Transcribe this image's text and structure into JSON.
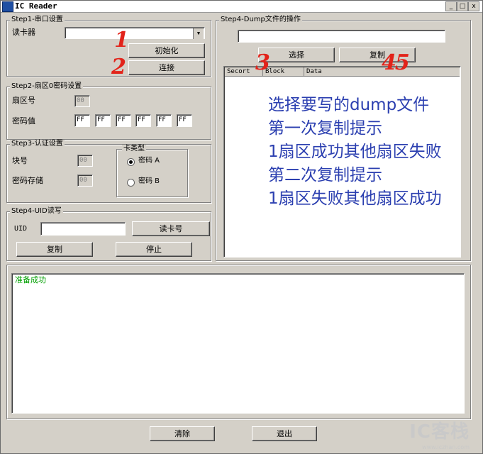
{
  "window": {
    "title": "IC Reader",
    "minimize_glyph": "_",
    "maximize_glyph": "□",
    "close_glyph": "x"
  },
  "step1": {
    "legend": "Step1-串口设置",
    "reader_label": "读卡器",
    "reader_value": "",
    "init_button": "初始化",
    "connect_button": "连接"
  },
  "step2": {
    "legend": "Step2-扇区0密码设置",
    "sector_label": "扇区号",
    "sector_value": "00",
    "password_label": "密码值",
    "password_bytes": [
      "FF",
      "FF",
      "FF",
      "FF",
      "FF",
      "FF"
    ]
  },
  "step3": {
    "legend": "Step3-认证设置",
    "block_label": "块号",
    "block_value": "00",
    "storage_label": "密码存储",
    "storage_value": "00",
    "card_type_legend": "卡类型",
    "option_a": "密码 A",
    "option_b": "密码 B",
    "selected": "A"
  },
  "step4_uid": {
    "legend": "Step4-UID读写",
    "uid_label": "UID",
    "uid_value": "",
    "read_button": "读卡号",
    "copy_button": "复制",
    "stop_button": "停止"
  },
  "step4_dump": {
    "legend": "Step4-Dump文件的操作",
    "file_path": "",
    "select_button": "选择",
    "copy_button": "复制",
    "columns": [
      "Secort",
      "Block",
      "Data"
    ]
  },
  "annotations": {
    "lines": [
      "选择要写的dump文件",
      "第一次复制提示",
      "1扇区成功其他扇区失败",
      "第二次复制提示",
      "1扇区失败其他扇区成功"
    ],
    "marks": {
      "one": "1",
      "two": "2",
      "three": "3",
      "four_five": "45"
    }
  },
  "log": {
    "lines": [
      "准备成功"
    ]
  },
  "footer": {
    "clear_button": "清除",
    "exit_button": "退出"
  },
  "watermark": {
    "logo": "IC客栈",
    "url": "www.iczhan.com"
  }
}
